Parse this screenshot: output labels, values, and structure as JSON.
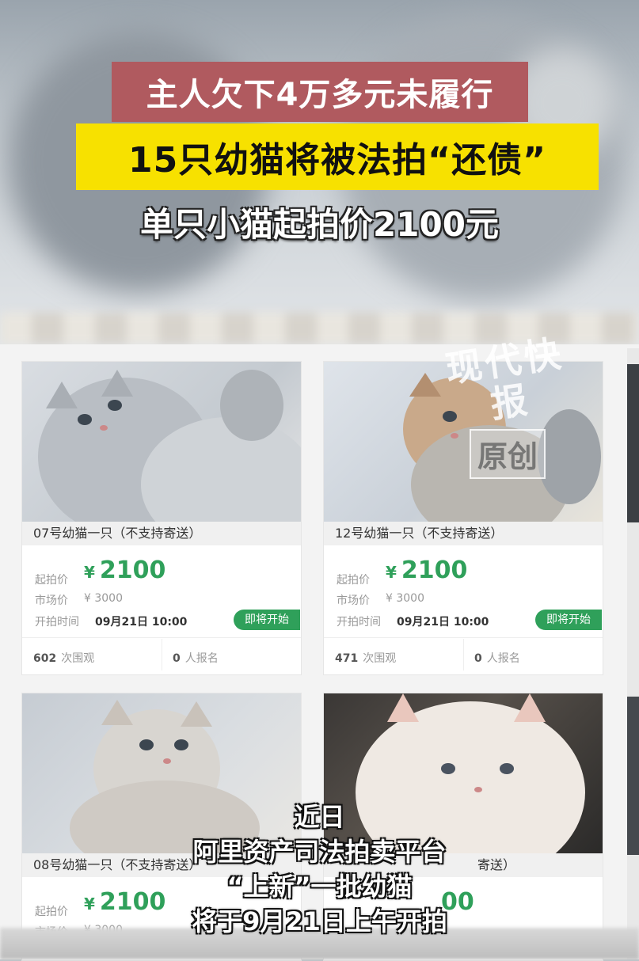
{
  "headline": {
    "line1": "主人欠下4万多元未履行",
    "line2": "15只幼猫将被法拍“还债”",
    "line3": "单只小猫起拍价2100元"
  },
  "watermark": {
    "brand": "现代快报",
    "tag": "原创"
  },
  "labels": {
    "start_price": "起拍价",
    "market_price": "市场价",
    "start_time": "开拍时间",
    "views_suffix": "次围观",
    "signups_suffix": "人报名",
    "status": "即将开始",
    "currency": "¥"
  },
  "listings": [
    {
      "name": "07号幼猫一只（不支持寄送）",
      "price": "2100",
      "market": "¥ 3000",
      "time": "09月21日 10:00",
      "views": "602",
      "signups": "0"
    },
    {
      "name": "12号幼猫一只（不支持寄送）",
      "price": "2100",
      "market": "¥ 3000",
      "time": "09月21日 10:00",
      "views": "471",
      "signups": "0"
    },
    {
      "name": "08号幼猫一只（不支持寄送）",
      "price": "2100",
      "market": "¥ 3000"
    },
    {
      "name": "寄送）",
      "price": "00"
    }
  ],
  "captions": [
    "近日",
    "阿里资产司法拍卖平台",
    "“上新”一批幼猫",
    "将于9月21日上午开拍"
  ],
  "colors": {
    "accent_green": "#2fa05a",
    "title_red": "#b05a5f",
    "title_yellow": "#f7e100"
  }
}
